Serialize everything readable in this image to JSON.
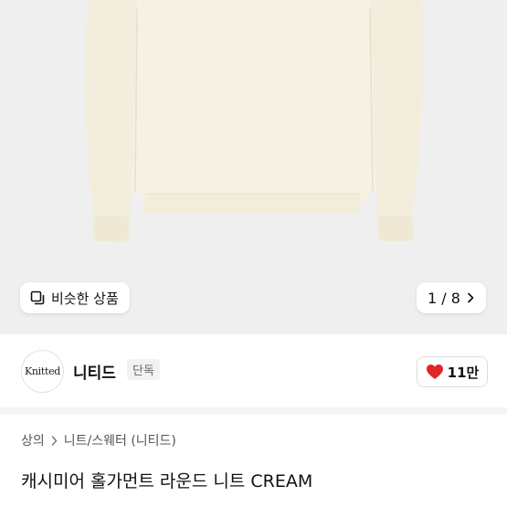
{
  "image": {
    "similar_button_label": "비슷한 상품",
    "pager_text": "1 / 8",
    "bg_color": "#efefef",
    "sweater_color": "#f6f1e2"
  },
  "brand": {
    "logo_text": "Knitted",
    "name": "니티드",
    "badge": "단독",
    "like_count": "11만",
    "like_color": "#e0262a"
  },
  "breadcrumb": [
    "상의",
    "니트/스웨터 (니티드)"
  ],
  "product": {
    "title": "캐시미어 홀가먼트 라운드 니트 CREAM"
  }
}
